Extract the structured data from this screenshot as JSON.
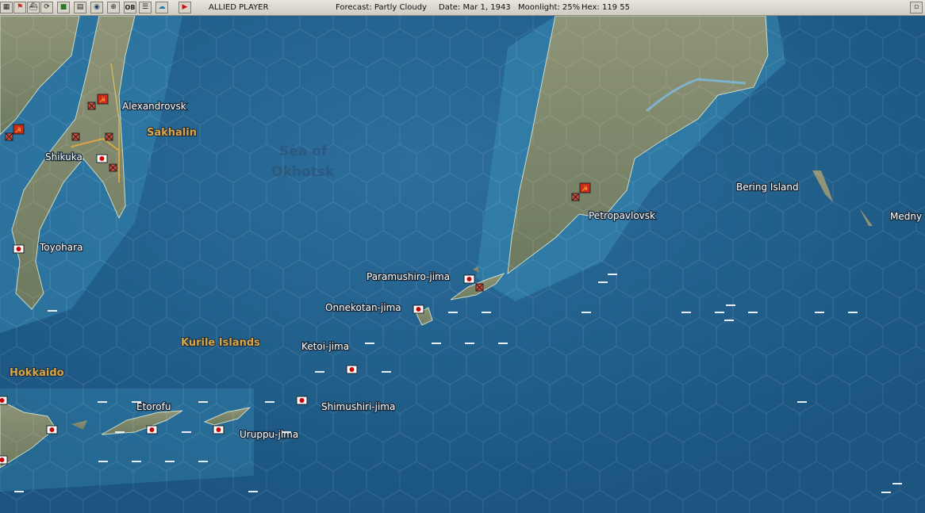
{
  "toolbar": {
    "player": "ALLIED PLAYER",
    "forecast": "Forecast: Partly Cloudy",
    "date": "Date: Mar 1, 1943",
    "moonlight": "Moonlight: 25%",
    "hex": "Hex: 119 55",
    "ob_label": "OB",
    "icons": [
      "flag-icon",
      "ship-icon",
      "cycle-icon",
      "factory-icon",
      "chart-icon",
      "globe-icon",
      "target-icon",
      "ob-icon",
      "list-icon",
      "cloud-icon",
      "play-icon"
    ]
  },
  "map": {
    "sea_name": [
      "Sea of",
      "Okhotsk"
    ],
    "regions": {
      "sakhalin": "Sakhalin",
      "kuriles": "Kurile Islands",
      "hokkaido": "Hokkaido"
    },
    "places": {
      "alexandrovsk": "Alexandrovsk",
      "shikuka": "Shikuka",
      "toyohara": "Toyohara",
      "petropavlovsk": "Petropavlovsk",
      "bering": "Bering Island",
      "medny": "Medny",
      "paramushiro": "Paramushiro-jima",
      "onnekotan": "Onnekotan-jima",
      "ketoi": "Ketoi-jima",
      "simushiri": "Shimushiri-jima",
      "etorofu": "Etorofu",
      "uruppu": "Uruppu-jima"
    },
    "colors": {
      "sea": "#1f5d8a",
      "japan_flag": "#cc0000",
      "soviet": "#cc2a1a",
      "region_text": "#d9a645"
    }
  }
}
